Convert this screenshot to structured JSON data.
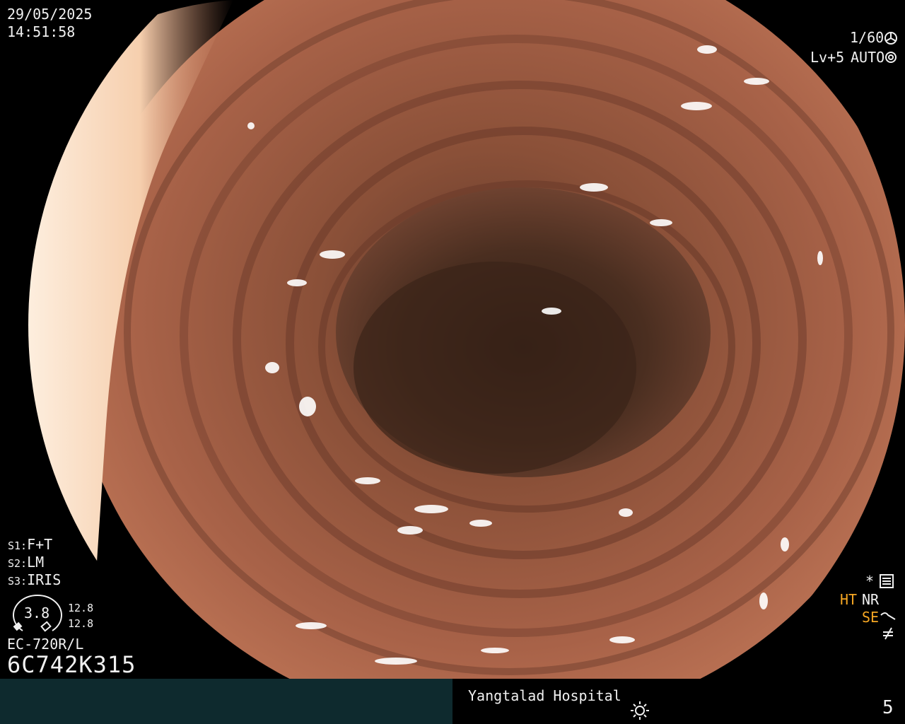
{
  "overlay": {
    "date": "29/05/2025",
    "time": "14:51:58",
    "shutter": "1/60",
    "shutter_icon": "aperture-icon",
    "level": "Lv+5",
    "mode": "AUTO",
    "mode_icon": "iris-icon",
    "s1_label": "S1:",
    "s1_value": "F+T",
    "s2_label": "S2:",
    "s2_value": "LM",
    "s3_label": "S3:",
    "s3_value": "IRIS",
    "gauge_value": "3.8",
    "gauge_top": "12.8",
    "gauge_bottom": "12.8",
    "scope_model": "EC-720R/L",
    "serial": "6C742K315",
    "star": "*",
    "ht": "HT",
    "nr": "NR",
    "se": "SE"
  },
  "footer": {
    "hospital": "Yangtalad Hospital",
    "brightness_icon": "sun-icon",
    "page": "5"
  },
  "colors": {
    "background": "#000000",
    "footer_left": "#0e2a2e",
    "accent_orange": "#f5a623",
    "tissue": "#9a5a44"
  }
}
